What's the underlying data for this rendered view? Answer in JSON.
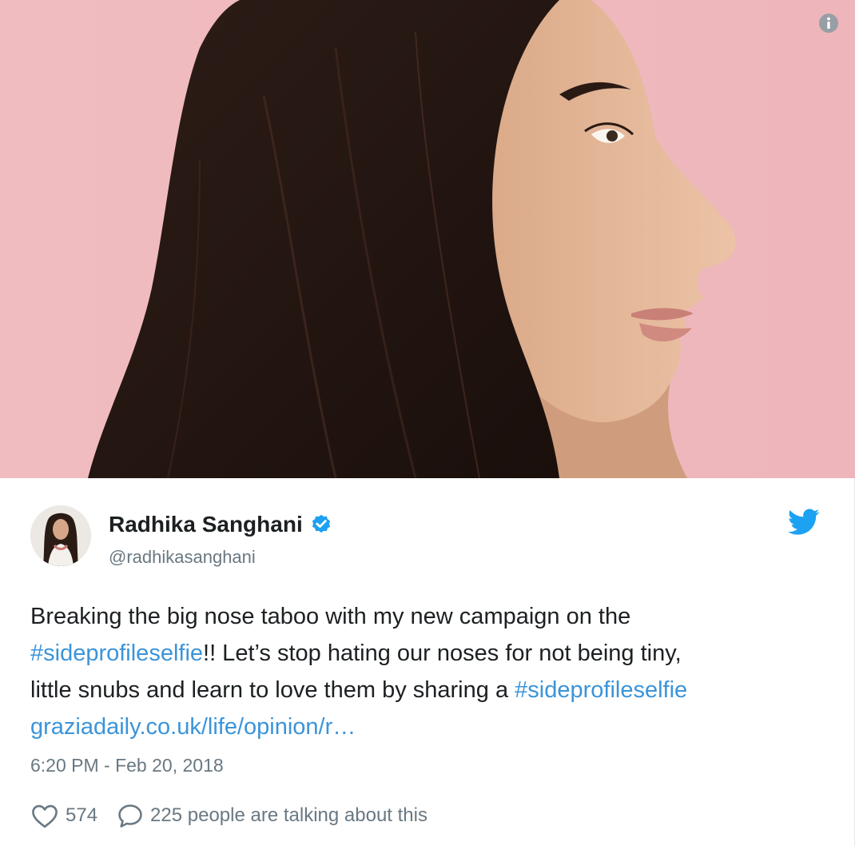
{
  "tweet": {
    "author": {
      "name": "Radhika Sanghani",
      "handle": "@radhikasanghani",
      "verified": true
    },
    "text": {
      "line1": "Breaking the big nose taboo with my new campaign on the",
      "hashtag1": "#sideprofileselfie",
      "line2_rest": "!! Let’s stop hating our noses for not being tiny,",
      "line3": "little snubs and learn to love them by sharing a ",
      "hashtag2": "#sideprofileselfie",
      "link": "graziadaily.co.uk/life/opinion/r…"
    },
    "timestamp": "6:20 PM - Feb 20, 2018",
    "likes": "574",
    "replies_text": "225 people are talking about this"
  },
  "icons": {
    "info": "info-icon",
    "verified": "verified-badge-icon",
    "brand": "twitter-bird-icon",
    "like": "heart-icon",
    "reply": "speech-bubble-icon"
  },
  "colors": {
    "link": "#3b94d9",
    "secondary_text": "#697882",
    "twitter_blue": "#1da1f2",
    "photo_background": "#efb9bd"
  }
}
